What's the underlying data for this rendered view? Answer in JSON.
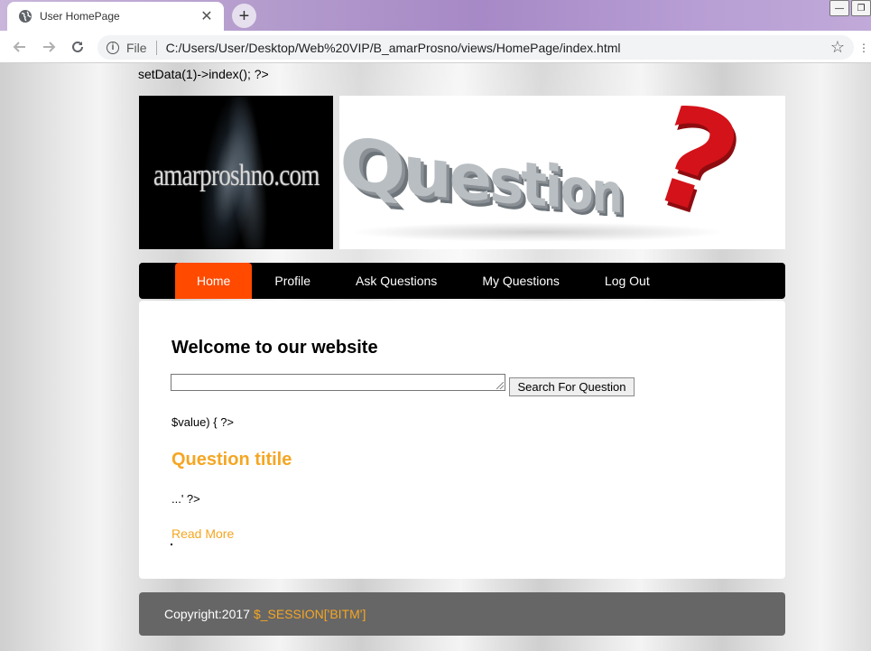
{
  "browser": {
    "tab_title": "User HomePage",
    "tab_close": "✕",
    "new_tab": "+",
    "address_label": "File",
    "url": "C:/Users/User/Desktop/Web%20VIP/B_amarProsno/views/HomePage/index.html",
    "icons": [
      "globe-icon",
      "back-icon",
      "forward-icon",
      "reload-icon",
      "info-icon",
      "star-icon"
    ]
  },
  "page": {
    "php_top": "setData(1)->index(); ?>",
    "banner_logo_text": "amarproshno.com",
    "banner_image_text": "Question",
    "menu": [
      {
        "label": "Home",
        "active": true
      },
      {
        "label": "Profile",
        "active": false
      },
      {
        "label": "Ask Questions",
        "active": false
      },
      {
        "label": "My Questions",
        "active": false
      },
      {
        "label": "Log Out",
        "active": false
      }
    ],
    "welcome_heading": "Welcome to our website",
    "search_input_value": "",
    "search_button": "Search For Question",
    "php_loop": "$value) { ?>",
    "question_title": "Question titile",
    "php_excerpt": "...' ?>",
    "read_more": "Read More",
    "footer": {
      "copyright": "Copyright:2017",
      "session": "$_SESSION['BITM']"
    }
  },
  "colors": {
    "menu_active": "#ff4a00",
    "accent_orange": "#f5a623",
    "footer_bg": "#666666",
    "menu_bg": "#000000"
  }
}
